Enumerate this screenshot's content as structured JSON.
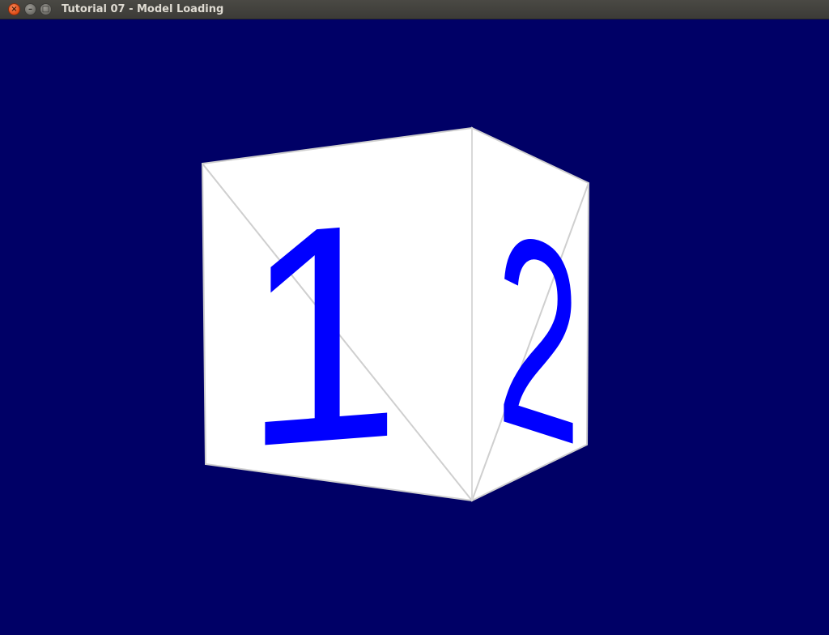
{
  "window": {
    "title": "Tutorial 07 - Model Loading",
    "close_glyph": "×",
    "minimize_glyph": "–",
    "maximize_glyph": "□"
  },
  "scene": {
    "background_color": "#000066",
    "cube": {
      "front_face_label": "1",
      "side_face_label": "2",
      "face_color": "#ffffff",
      "digit_color": "#0000ff",
      "edge_color": "#cfcfcf"
    }
  }
}
